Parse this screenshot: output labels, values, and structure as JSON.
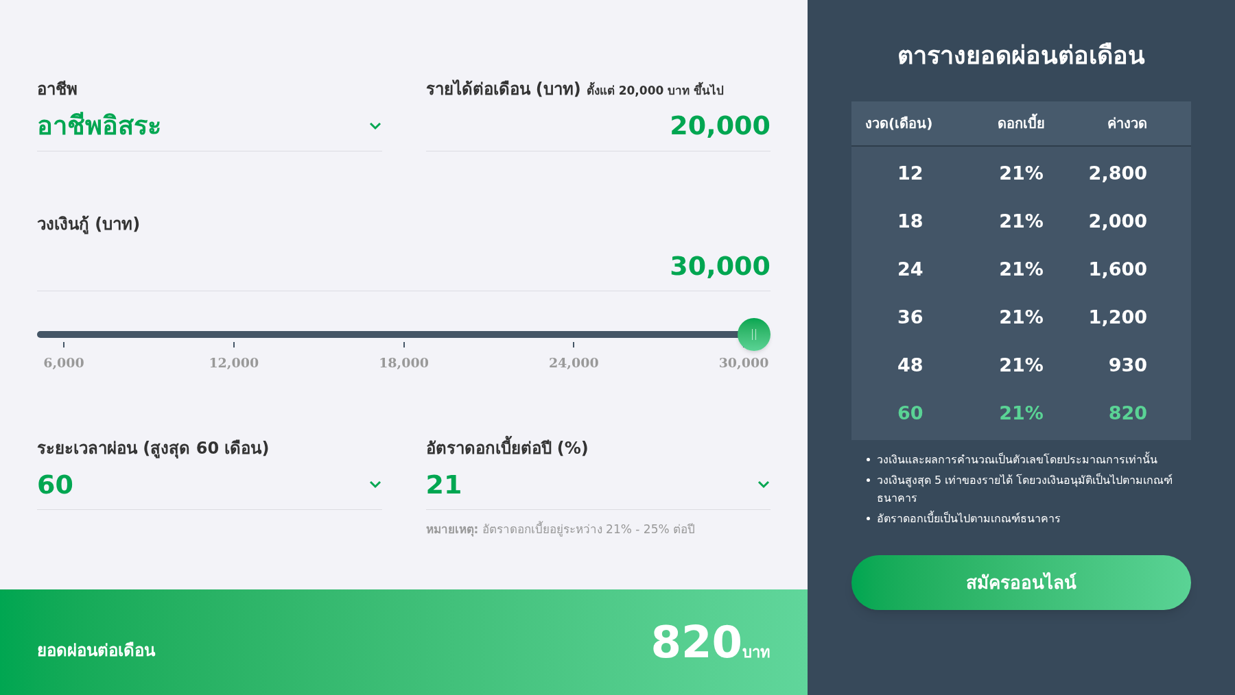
{
  "form": {
    "occupation": {
      "label": "อาชีพ",
      "value": "อาชีพอิสระ"
    },
    "income": {
      "label": "รายได้ต่อเดือน (บาท)",
      "hint": "ตั้งแต่ 20,000 บาท ขึ้นไป",
      "value": "20,000"
    },
    "loan": {
      "label": "วงเงินกู้ (บาท)",
      "value": "30,000",
      "slider": {
        "level": 1,
        "ticks": [
          "6,000",
          "12,000",
          "18,000",
          "24,000",
          "30,000"
        ]
      }
    },
    "duration": {
      "label": "ระยะเวลาผ่อน (สูงสุด 60 เดือน)",
      "value": "60"
    },
    "rate": {
      "label": "อัตราดอกเบี้ยต่อปี (%)",
      "value": "21",
      "note_label": "หมายเหตุ:",
      "note": "อัตราดอกเบี้ยอยู่ระหว่าง 21% - 25% ต่อปี"
    }
  },
  "result": {
    "label": "ยอดผ่อนต่อเดือน",
    "amount": "820",
    "unit": "บาท"
  },
  "table": {
    "title": "ตารางยอดผ่อนต่อเดือน",
    "columns": [
      "งวด(เดือน)",
      "ดอกเบี้ย",
      "ค่างวด"
    ],
    "rows": [
      {
        "cells": [
          "12",
          "21%",
          "2,800"
        ],
        "selected": false
      },
      {
        "cells": [
          "18",
          "21%",
          "2,000"
        ],
        "selected": false
      },
      {
        "cells": [
          "24",
          "21%",
          "1,600"
        ],
        "selected": false
      },
      {
        "cells": [
          "36",
          "21%",
          "1,200"
        ],
        "selected": false
      },
      {
        "cells": [
          "48",
          "21%",
          "930"
        ],
        "selected": false
      },
      {
        "cells": [
          "60",
          "21%",
          "820"
        ],
        "selected": true
      }
    ]
  },
  "notes": [
    "วงเงินและผลการคำนวณเป็นตัวเลขโดยประมาณการเท่านั้น",
    "วงเงินสูงสุด 5 เท่าของรายได้ โดยวงเงินอนุมัติเป็นไปตามเกณฑ์ธนาคาร",
    "อัตราดอกเบี้ยเป็นไปตามเกณฑ์ธนาคาร"
  ],
  "apply_button": "สมัครออนไลน์"
}
